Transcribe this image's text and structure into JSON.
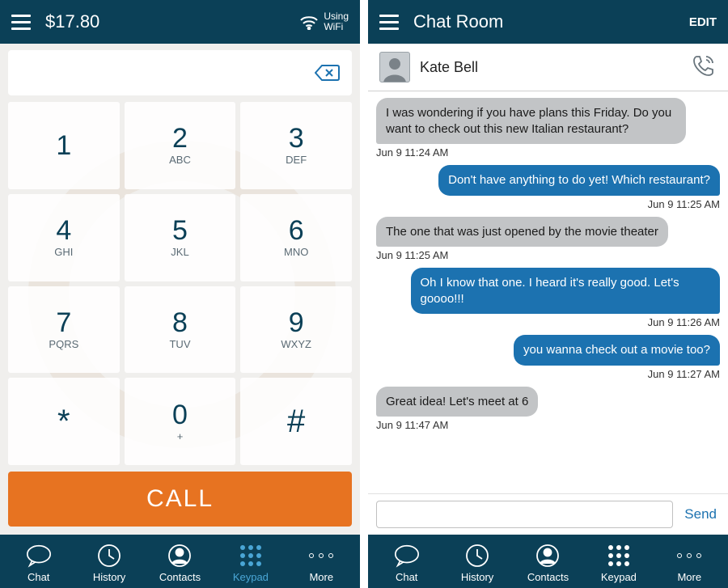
{
  "left": {
    "balance": "$17.80",
    "wifi_line1": "Using",
    "wifi_line2": "WiFi",
    "keys": [
      {
        "digit": "1",
        "letters": ""
      },
      {
        "digit": "2",
        "letters": "ABC"
      },
      {
        "digit": "3",
        "letters": "DEF"
      },
      {
        "digit": "4",
        "letters": "GHI"
      },
      {
        "digit": "5",
        "letters": "JKL"
      },
      {
        "digit": "6",
        "letters": "MNO"
      },
      {
        "digit": "7",
        "letters": "PQRS"
      },
      {
        "digit": "8",
        "letters": "TUV"
      },
      {
        "digit": "9",
        "letters": "WXYZ"
      },
      {
        "digit": "*",
        "letters": ""
      },
      {
        "digit": "0",
        "letters": "+"
      },
      {
        "digit": "#",
        "letters": ""
      }
    ],
    "call_label": "CALL",
    "nav": {
      "chat": "Chat",
      "history": "History",
      "contacts": "Contacts",
      "keypad": "Keypad",
      "more": "More"
    }
  },
  "right": {
    "header_title": "Chat Room",
    "edit_label": "EDIT",
    "contact_name": "Kate Bell",
    "messages": [
      {
        "dir": "in",
        "text": "I was wondering if you have plans this Friday. Do you want to check out this new Italian restaurant?",
        "time": "Jun 9 11:24 AM"
      },
      {
        "dir": "out",
        "text": "Don't have anything to do yet! Which restaurant?",
        "time": "Jun 9 11:25 AM"
      },
      {
        "dir": "in",
        "text": "The one that was just opened by the movie theater",
        "time": "Jun 9 11:25 AM"
      },
      {
        "dir": "out",
        "text": "Oh I know that one. I heard it's really good. Let's goooo!!!",
        "time": "Jun 9 11:26 AM"
      },
      {
        "dir": "out",
        "text": "you wanna check out a movie too?",
        "time": "Jun 9 11:27 AM"
      },
      {
        "dir": "in",
        "text": "Great idea! Let's meet at 6",
        "time": "Jun 9 11:47 AM"
      }
    ],
    "input_placeholder": "",
    "send_label": "Send",
    "nav": {
      "chat": "Chat",
      "history": "History",
      "contacts": "Contacts",
      "keypad": "Keypad",
      "more": "More"
    }
  }
}
